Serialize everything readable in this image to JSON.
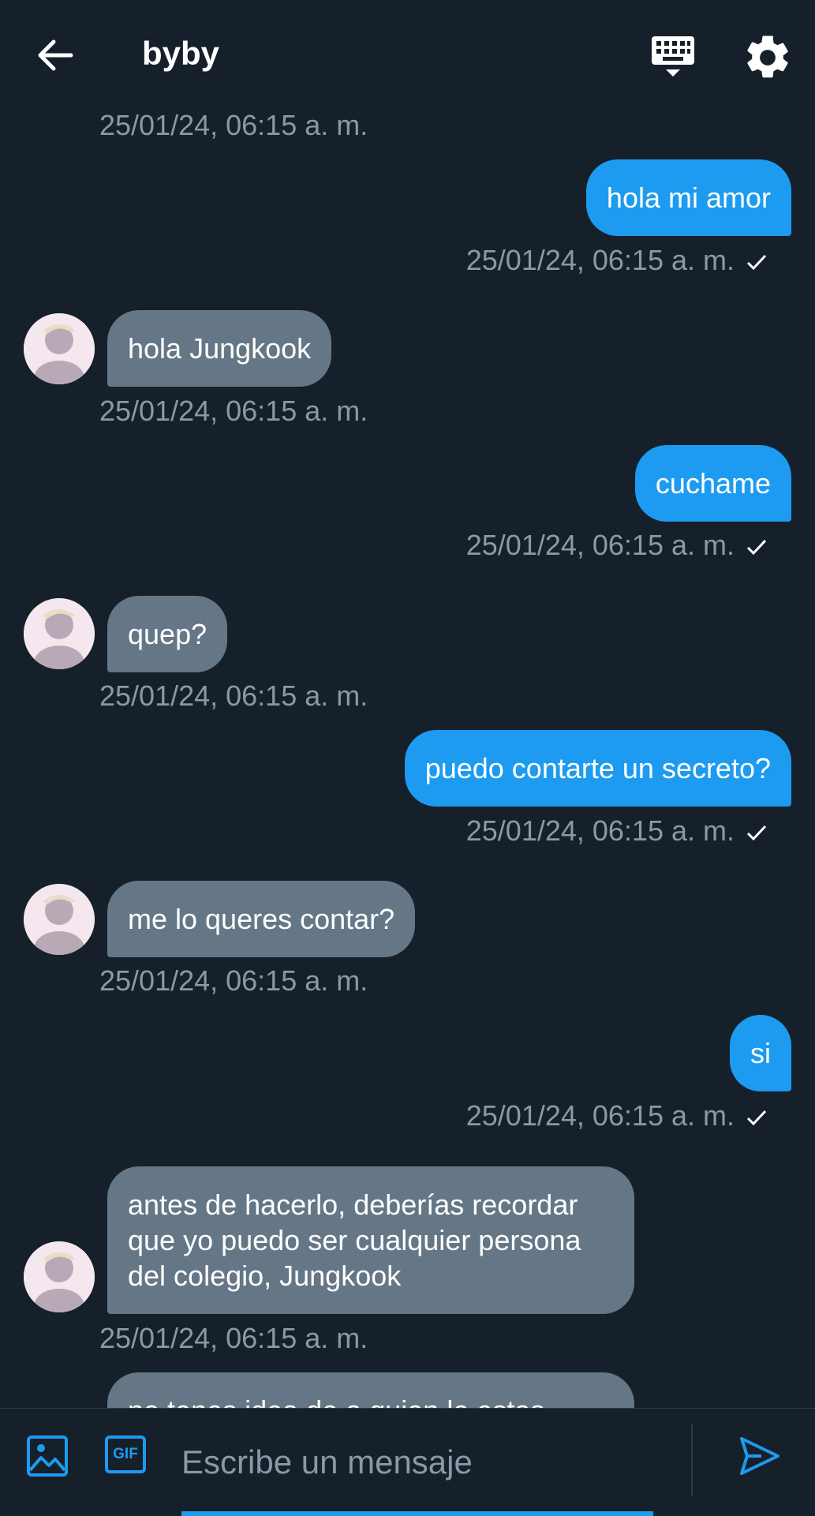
{
  "header": {
    "title": "byby",
    "back_icon": "arrow-left-icon",
    "keyboard_icon": "keyboard-icon",
    "settings_icon": "gear-icon"
  },
  "colors": {
    "background": "#16202a",
    "outgoing_bubble": "#1d9bf0",
    "incoming_bubble": "#657786",
    "timestamp": "#8b98a5"
  },
  "messages": [
    {
      "direction": "in",
      "text": "",
      "timestamp": "25/01/24, 06:15 a. m."
    },
    {
      "direction": "out",
      "text": "hola mi amor",
      "timestamp": "25/01/24, 06:15 a. m."
    },
    {
      "direction": "in",
      "text": "hola Jungkook",
      "timestamp": "25/01/24, 06:15 a. m."
    },
    {
      "direction": "out",
      "text": "cuchame",
      "timestamp": "25/01/24, 06:15 a. m."
    },
    {
      "direction": "in",
      "text": "quep?",
      "timestamp": "25/01/24, 06:15 a. m."
    },
    {
      "direction": "out",
      "text": "puedo contarte un secreto?",
      "timestamp": "25/01/24, 06:15 a. m."
    },
    {
      "direction": "in",
      "text": "me lo queres contar?",
      "timestamp": "25/01/24, 06:15 a. m."
    },
    {
      "direction": "out",
      "text": "si",
      "timestamp": "25/01/24, 06:15 a. m."
    },
    {
      "direction": "in",
      "lines": [
        "antes de hacerlo, deberías recordar",
        "que yo puedo ser cualquier persona",
        "del colegio, Jungkook"
      ],
      "timestamp": "25/01/24, 06:15 a. m."
    },
    {
      "direction": "in",
      "text": "no tenes idea de a quien le estas",
      "partial": true
    }
  ],
  "composer": {
    "placeholder": "Escribe un mensaje",
    "image_icon": "image-icon",
    "gif_label": "GIF",
    "send_icon": "send-icon"
  }
}
